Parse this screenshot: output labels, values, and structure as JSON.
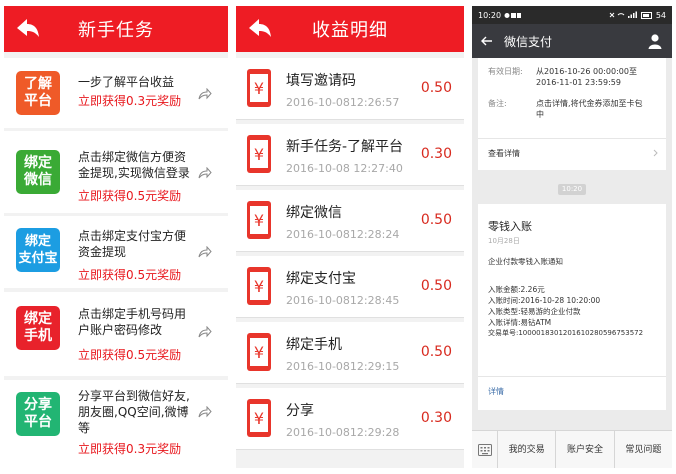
{
  "panel1": {
    "title": "新手任务",
    "tasks": [
      {
        "icon_text": "了解\n平台",
        "icon_color": "#ef5a28",
        "desc": "一步了解平台收益",
        "reward": "立即获得0.3元奖励"
      },
      {
        "icon_text": "绑定\n微信",
        "icon_color": "#3aaa35",
        "desc": "点击绑定微信方便资金提现,实现微信登录",
        "reward": "立即获得0.5元奖励"
      },
      {
        "icon_text": "绑定\n支付宝",
        "icon_color": "#1c9de2",
        "desc": "点击绑定支付宝方便资金提现",
        "reward": "立即获得0.5元奖励"
      },
      {
        "icon_text": "绑定\n手机",
        "icon_color": "#e8222b",
        "desc": "点击绑定手机号码用户账户密码修改",
        "reward": "立即获得0.5元奖励"
      },
      {
        "icon_text": "分享\n平台",
        "icon_color": "#22b573",
        "desc": "分享平台到微信好友,朋友圈,QQ空间,微博等",
        "reward": "立即获得0.3元奖励"
      }
    ]
  },
  "panel2": {
    "title": "收益明细",
    "icon_glyph": "¥",
    "rows": [
      {
        "title": "填写邀请码",
        "date": "2016-10-0812:26:57",
        "amount": "0.50"
      },
      {
        "title": "新手任务-了解平台",
        "date": "2016-10-08 12:27:40",
        "amount": "0.30"
      },
      {
        "title": "绑定微信",
        "date": "2016-10-0812:28:24",
        "amount": "0.50"
      },
      {
        "title": "绑定支付宝",
        "date": "2016-10-0812:28:45",
        "amount": "0.50"
      },
      {
        "title": "绑定手机",
        "date": "2016-10-0812:29:15",
        "amount": "0.50"
      },
      {
        "title": "分享",
        "date": "2016-10-0812:29:28",
        "amount": "0.30"
      }
    ]
  },
  "panel3": {
    "status": {
      "time": "10:20",
      "battery": "54"
    },
    "title": "微信支付",
    "card1": {
      "valid_label": "有效日期:",
      "valid_value": "从2016-10-26 00:00:00至2016-11-01 23:59:59",
      "note_label": "备注:",
      "note_value": "点击详情,将代金券添加至卡包中",
      "details": "查看详情"
    },
    "time_pill": "10:20",
    "card2": {
      "title": "零钱入账",
      "date": "10月28日",
      "subtitle": "企业付款零钱入账通知",
      "lines": [
        "入账金额:2.26元",
        "入账时间:2016-10-28 10:20:00",
        "入账类型:轻易游的企业付款",
        "入账详情:易钻ATM",
        "交易单号:1000018301201610280596753572"
      ],
      "details": "详情"
    },
    "bottom_menu": [
      "我的交易",
      "账户安全",
      "常见问题"
    ]
  }
}
